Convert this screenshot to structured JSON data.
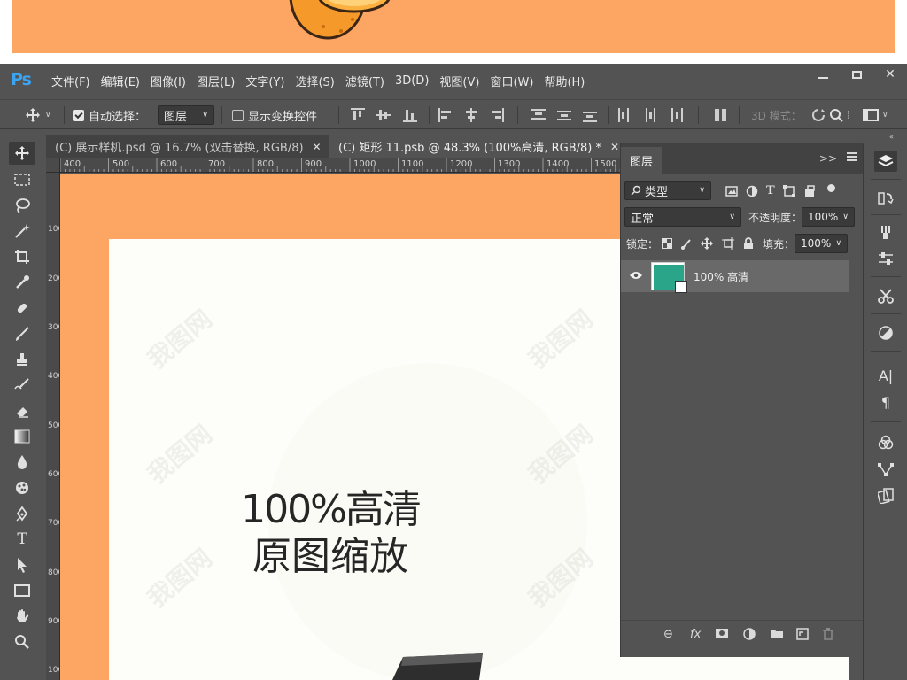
{
  "app": {
    "logo": "Ps"
  },
  "menu": [
    "文件(F)",
    "编辑(E)",
    "图像(I)",
    "图层(L)",
    "文字(Y)",
    "选择(S)",
    "滤镜(T)",
    "3D(D)",
    "视图(V)",
    "窗口(W)",
    "帮助(H)"
  ],
  "window_controls": {
    "close": "✕"
  },
  "options": {
    "auto_select_label": "自动选择：",
    "auto_select_checked": true,
    "auto_select_value": "图层",
    "show_transform_label": "显示变换控件",
    "show_transform_checked": false,
    "mode_3d_label": "3D 模式："
  },
  "tabs": [
    {
      "label": "(C) 展示样机.psd @ 16.7% (双击替换, RGB/8)",
      "active": false,
      "close": "✕"
    },
    {
      "label": "(C) 矩形 11.psb @ 48.3% (100%高清, RGB/8) *",
      "active": true,
      "close": "✕"
    }
  ],
  "ruler": {
    "top_labels": [
      "400",
      "500",
      "600",
      "700",
      "800",
      "900",
      "1000",
      "1100",
      "1200",
      "1300",
      "1400",
      "1500"
    ],
    "left_labels": [
      "100",
      "200",
      "300",
      "400",
      "500",
      "600",
      "700",
      "800",
      "900",
      "100"
    ]
  },
  "canvas": {
    "line1": "100%高清",
    "line2": "原图缩放",
    "bg_color": "#fda562",
    "artboard_color": "#fdfdf9"
  },
  "layers_panel": {
    "tab_label": "图层",
    "more": ">>",
    "filter_label": "类型",
    "blend_mode": "正常",
    "opacity_label": "不透明度：",
    "opacity_value": "100%",
    "lock_label": "锁定：",
    "fill_label": "填充：",
    "fill_value": "100%",
    "layers": [
      {
        "name": "100% 高清",
        "visible": true,
        "thumb_color": "#2ba58a"
      }
    ]
  },
  "watermark": "我图网"
}
